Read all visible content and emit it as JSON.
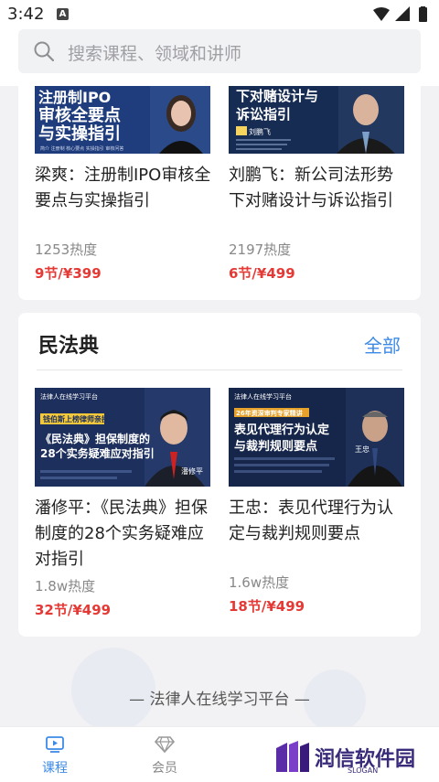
{
  "status_bar": {
    "time": "3:42",
    "notif_letter": "A"
  },
  "search": {
    "placeholder": "搜索课程、领域和讲师"
  },
  "top_courses": [
    {
      "title": "梁爽：注册制IPO审核全要点与实操指引",
      "heat": "1253热度",
      "price": "9节/¥399",
      "thumb_lines": [
        "注册制IPO",
        "审核全要点",
        "与实操指引"
      ],
      "thumb_small": "简介 注册制 核心要点 实操指引 审核问答"
    },
    {
      "title": "刘鹏飞：新公司法形势下对赌设计与诉讼指引",
      "heat": "2197热度",
      "price": "6节/¥499",
      "thumb_lines": [
        "下对赌设计与",
        "诉讼指引"
      ],
      "thumb_name": "刘鹏飞"
    }
  ],
  "section": {
    "title": "民法典",
    "all_label": "全部",
    "courses": [
      {
        "title": "潘修平：《民法典》担保制度的28个实务疑难应对指引",
        "heat": "1.8w热度",
        "price": "32节/¥499",
        "thumb_header": "法律人在线学习平台",
        "thumb_badge": "钱伯斯上榜律师亲授",
        "thumb_lines": [
          "《民法典》担保制度的",
          "28个实务疑难应对指引"
        ],
        "thumb_name": "潘修平"
      },
      {
        "title": "王忠：表见代理行为认定与裁判规则要点",
        "heat": "1.6w热度",
        "price": "18节/¥499",
        "thumb_header": "法律人在线学习平台",
        "thumb_badge": "26年资深审判专家精讲",
        "thumb_lines": [
          "表见代理行为认定",
          "与裁判规则要点"
        ],
        "thumb_name": "王忠"
      }
    ]
  },
  "slogan": "— 法律人在线学习平台 —",
  "tabs": [
    {
      "label": "课程",
      "icon": "course-icon"
    },
    {
      "label": "会员",
      "icon": "diamond-icon"
    }
  ],
  "watermark": {
    "text": "润信软件园",
    "slogan": "SLOGAN"
  },
  "colors": {
    "accent": "#3c8ae8",
    "price": "#e53935",
    "thumb_bg": "#1d2f5c"
  }
}
